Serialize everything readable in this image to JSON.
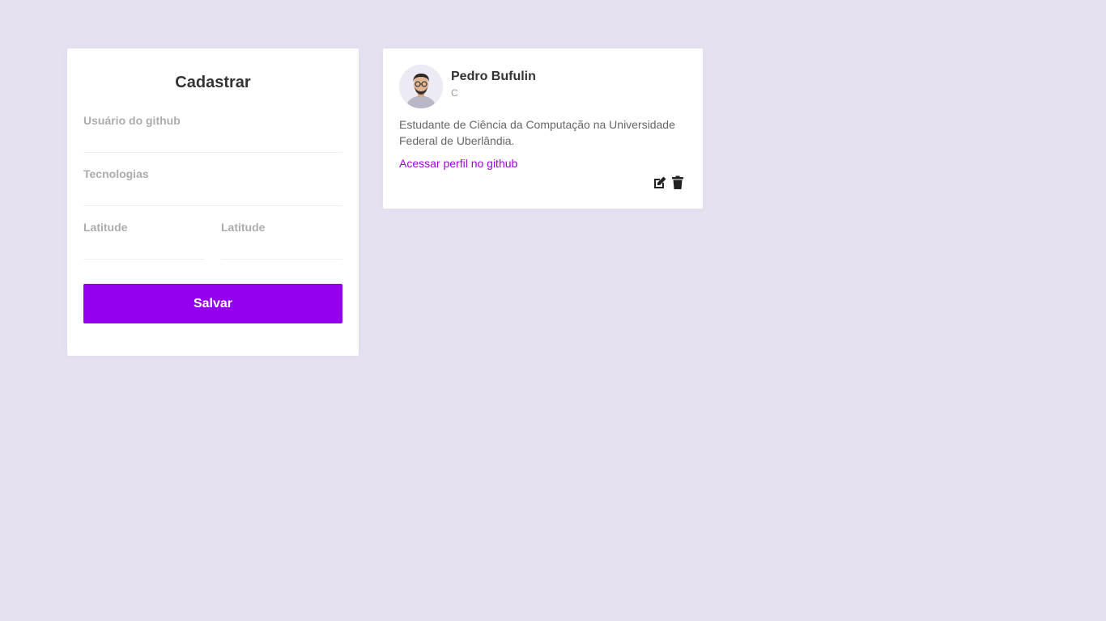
{
  "form": {
    "title": "Cadastrar",
    "github_user_label": "Usuário do github",
    "github_user_value": "",
    "techs_label": "Tecnologias",
    "techs_value": "",
    "latitude_label": "Latitude",
    "latitude_value": "",
    "longitude_label": "Latitude",
    "longitude_value": "",
    "save_label": "Salvar"
  },
  "dev": {
    "name": "Pedro Bufulin",
    "techs": "C",
    "bio": "Estudante de Ciência da Computação na Universidade Federal de Uberlândia.",
    "link_label": "Acessar perfil no github",
    "edit_icon": "edit-icon",
    "delete_icon": "trash-icon"
  },
  "colors": {
    "background": "#e6e1f0",
    "accent": "#9400ef",
    "link": "#a000e8"
  }
}
